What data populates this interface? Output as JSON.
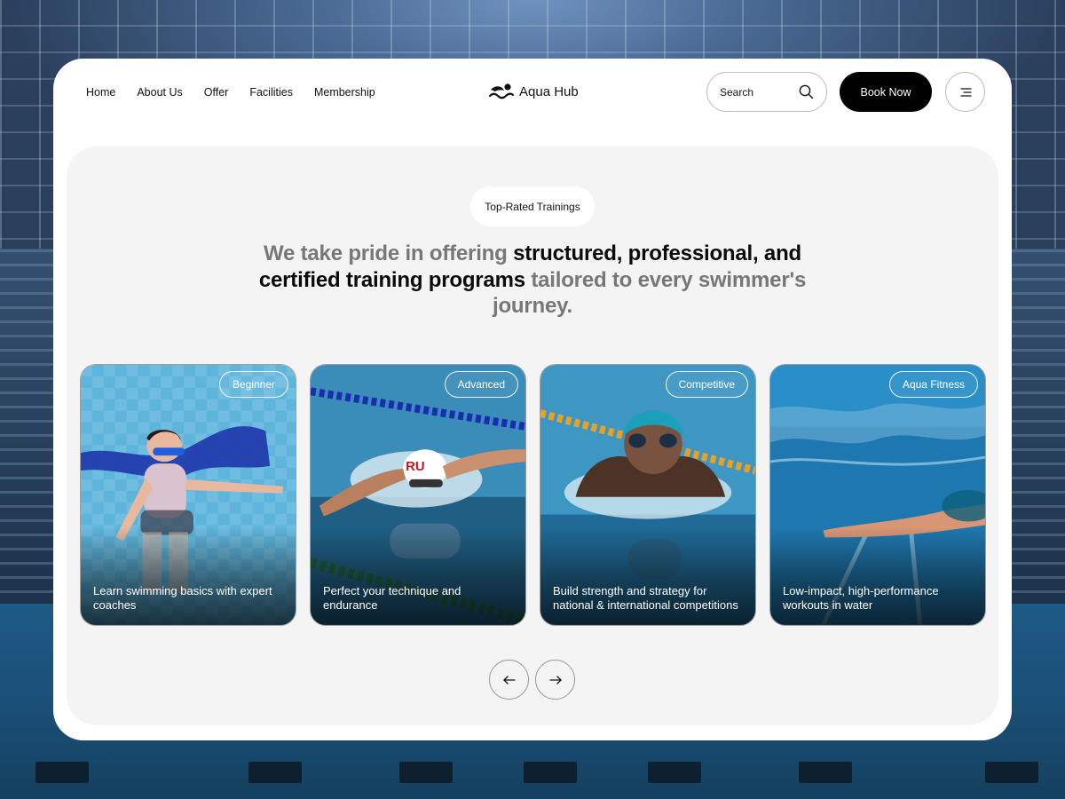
{
  "nav": {
    "items": [
      "Home",
      "About Us",
      "Offer",
      "Facilities",
      "Membership"
    ]
  },
  "brand": {
    "name": "Aqua Hub"
  },
  "search": {
    "placeholder": "Search",
    "icon": "search-icon"
  },
  "header": {
    "book_label": "Book Now",
    "menu_icon": "menu-icon"
  },
  "section": {
    "badge": "Top-Rated Trainings",
    "heading_part1": "We take pride in offering ",
    "heading_bold": "structured, professional, and certified training programs",
    "heading_part2": " tailored to every swimmer's journey."
  },
  "trainings": [
    {
      "tag": "Beginner",
      "description": "Learn swimming basics with expert coaches"
    },
    {
      "tag": "Advanced",
      "description": "Perfect your technique and endurance"
    },
    {
      "tag": "Competitive",
      "description": "Build strength and strategy for national & international competitions"
    },
    {
      "tag": "Aqua Fitness",
      "description": "Low-impact, high-performance workouts in water"
    }
  ],
  "carousel": {
    "prev_icon": "arrow-left-icon",
    "next_icon": "arrow-right-icon"
  },
  "colors": {
    "primary": "#000000",
    "card_bg": "#ffffff",
    "panel_bg": "#f4f4f4",
    "heading_muted": "#777777",
    "heading_strong": "#0b0b0b"
  }
}
